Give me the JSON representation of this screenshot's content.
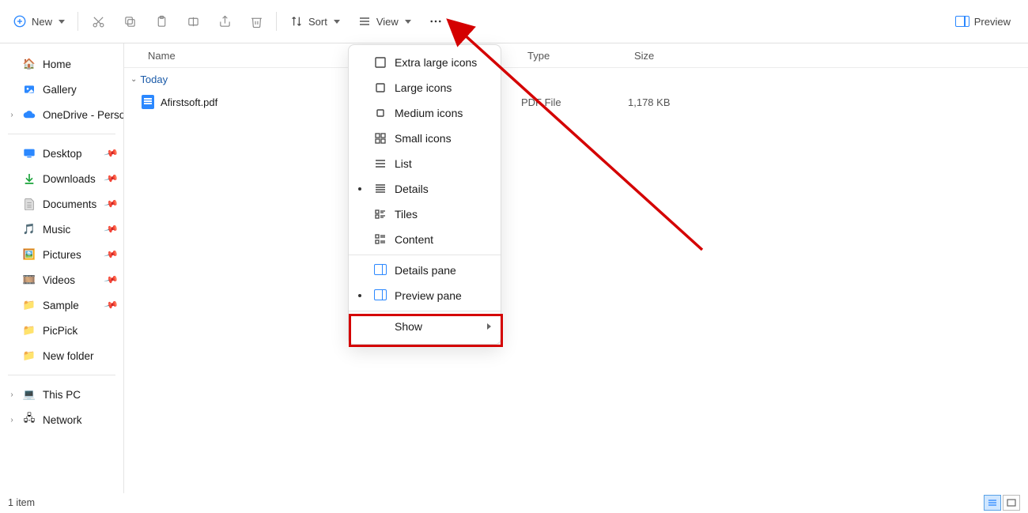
{
  "toolbar": {
    "new_label": "New",
    "sort_label": "Sort",
    "view_label": "View",
    "preview_label": "Preview"
  },
  "sidebar": {
    "home": "Home",
    "gallery": "Gallery",
    "onedrive": "OneDrive - Persona",
    "quick": [
      {
        "label": "Desktop"
      },
      {
        "label": "Downloads"
      },
      {
        "label": "Documents"
      },
      {
        "label": "Music"
      },
      {
        "label": "Pictures"
      },
      {
        "label": "Videos"
      },
      {
        "label": "Sample"
      },
      {
        "label": "PicPick"
      },
      {
        "label": "New folder"
      }
    ],
    "this_pc": "This PC",
    "network": "Network"
  },
  "columns": {
    "name": "Name",
    "type": "Type",
    "size": "Size"
  },
  "group": {
    "label": "Today"
  },
  "file": {
    "name": "Afirstsoft.pdf",
    "type": "PDF File",
    "size": "1,178 KB"
  },
  "menu": {
    "xl_icons": "Extra large icons",
    "l_icons": "Large icons",
    "m_icons": "Medium icons",
    "s_icons": "Small icons",
    "list": "List",
    "details": "Details",
    "tiles": "Tiles",
    "content": "Content",
    "details_pane": "Details pane",
    "preview_pane": "Preview pane",
    "show": "Show"
  },
  "status": {
    "count": "1 item"
  }
}
